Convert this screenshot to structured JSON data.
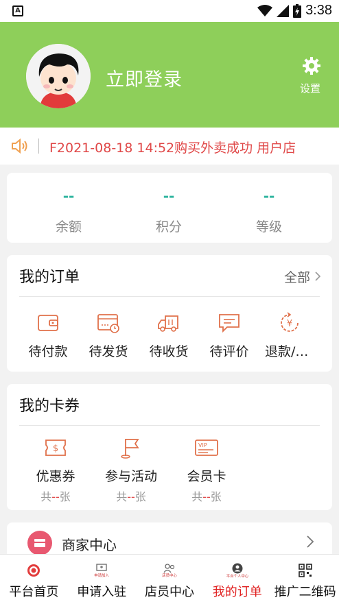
{
  "status_bar": {
    "time": "3:38"
  },
  "header": {
    "login_text": "立即登录",
    "settings_label": "设置",
    "bg_color": "#8ecf5a"
  },
  "notice": {
    "text": "F2021-08-18 14:52购买外卖成功   用户店"
  },
  "stats": [
    {
      "value": "--",
      "label": "余额"
    },
    {
      "value": "--",
      "label": "积分"
    },
    {
      "value": "--",
      "label": "等级"
    }
  ],
  "orders": {
    "title": "我的订单",
    "more": "全部",
    "items": [
      {
        "label": "待付款",
        "icon": "wallet-icon"
      },
      {
        "label": "待发货",
        "icon": "calendar-clock-icon"
      },
      {
        "label": "待收货",
        "icon": "truck-icon"
      },
      {
        "label": "待评价",
        "icon": "comment-icon"
      },
      {
        "label": "退款/售后",
        "icon": "refund-icon"
      }
    ]
  },
  "coupons": {
    "title": "我的卡券",
    "items": [
      {
        "label": "优惠券",
        "prefix": "共",
        "count": "--",
        "unit": "张",
        "icon": "coupon-icon"
      },
      {
        "label": "参与活动",
        "prefix": "共",
        "count": "--",
        "unit": "张",
        "icon": "flag-icon"
      },
      {
        "label": "会员卡",
        "prefix": "共",
        "count": "--",
        "unit": "张",
        "icon": "vip-card-icon"
      }
    ]
  },
  "merchant": {
    "label": "商家中心"
  },
  "tabs": [
    {
      "label": "平台首页",
      "tiny": ""
    },
    {
      "label": "申请入驻",
      "tiny": "申请加入"
    },
    {
      "label": "店员中心",
      "tiny": "店员中心"
    },
    {
      "label": "我的订单",
      "tiny": "平台个人中心"
    },
    {
      "label": "推广二维码",
      "tiny": ""
    }
  ],
  "colors": {
    "accent": "#e04848",
    "teal": "#2bb39d",
    "active_tab": "#e02020"
  }
}
